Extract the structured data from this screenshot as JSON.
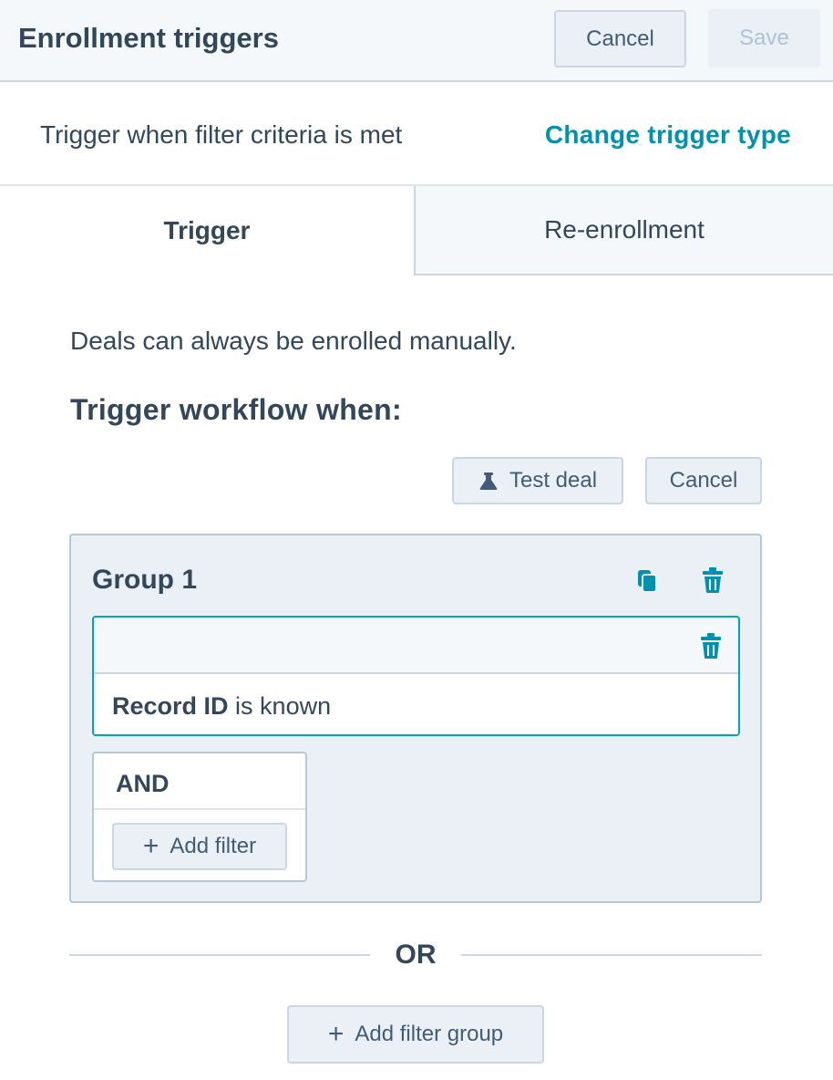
{
  "header": {
    "title": "Enrollment triggers",
    "cancel_label": "Cancel",
    "save_label": "Save"
  },
  "trigger_type": {
    "description": "Trigger when filter criteria is met",
    "change_label": "Change trigger type"
  },
  "tabs": [
    {
      "label": "Trigger",
      "active": true
    },
    {
      "label": "Re-enrollment",
      "active": false
    }
  ],
  "body": {
    "manual_note": "Deals can always be enrolled manually.",
    "workflow_heading": "Trigger workflow when:",
    "test_deal_label": "Test deal",
    "cancel_label": "Cancel"
  },
  "group": {
    "title": "Group 1",
    "filter": {
      "property": "Record ID",
      "condition": "is known"
    },
    "and_label": "AND",
    "add_filter_label": "Add filter"
  },
  "or_label": "OR",
  "add_filter_group_label": "Add filter group",
  "colors": {
    "accent": "#0091ae",
    "text": "#33475b",
    "border": "#cbd6e2",
    "group_bg": "#eaf0f6",
    "active_filter_border": "#00a4bd"
  },
  "icons": {
    "test_deal": "flask-icon",
    "copy": "copy-icon",
    "delete": "trash-icon",
    "add": "plus-icon"
  }
}
